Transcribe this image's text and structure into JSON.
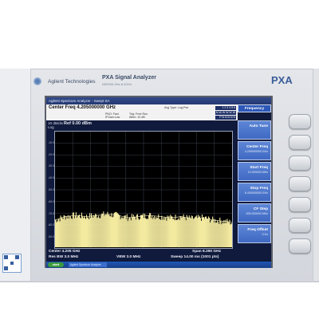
{
  "instrument": {
    "brand": "Agilent Technologies",
    "model": "PXA Signal Analyzer",
    "model_sub": "N9030A   3Hz-8.4GHz",
    "badge": "PXA"
  },
  "screen": {
    "window_title": "Agilent Spectrum Analyzer - Swept SA",
    "center_freq_line": "Center Freq 4.205000000 GHz",
    "status_a": "PNO: Fast",
    "status_b": "IFGain:Low",
    "trig": "Trig: Free Run",
    "atten": "Atten: 10 dB",
    "avg_type": "Avg Type: Log-Pwr",
    "trace_row1": "1 2 3 4 5 6",
    "trace_row2": "M W W W W W",
    "trace_row3": "P N N N N N",
    "scale": "10 dB/div",
    "scale_type": "Log",
    "ref_level": "Ref 0.00 dBm",
    "y_ticks": [
      "-10.0",
      "-20.0",
      "-30.0",
      "-40.0",
      "-50.0",
      "-60.0",
      "-70.0",
      "-80.0",
      "-90.0"
    ],
    "center": "Center 4.205 GHz",
    "res_bw": "Res BW 3.0 MHz",
    "vbw": "VBW 3.0 MHz",
    "span": "Span 8.390 GHz",
    "sweep": "Sweep  14.00 ms (1001 pts)"
  },
  "menu": {
    "title": "Frequency",
    "keys": [
      {
        "label": "Auto Tune",
        "value": ""
      },
      {
        "label": "Center Freq",
        "value": "4.205000000 GHz"
      },
      {
        "label": "Start Freq",
        "value": "10.000000 MHz"
      },
      {
        "label": "Stop Freq",
        "value": "8.400000000 GHz"
      },
      {
        "label": "CF Step",
        "value": "839.000000 MHz"
      },
      {
        "label": "Freq Offset",
        "value": "0 Hz"
      }
    ]
  },
  "taskbar": {
    "start": "start",
    "task": "Agilent Spectrum Analyzer",
    "clock": ""
  },
  "chart_data": {
    "type": "line",
    "x_start_ghz": 0.01,
    "x_stop_ghz": 8.4,
    "ylim": [
      -100,
      0
    ],
    "ylabel": "10 dB/div",
    "grid": true,
    "series": [
      {
        "color": "#f3eaa0",
        "x": [
          0.01,
          0.5,
          1.0,
          1.5,
          2.0,
          2.5,
          3.0,
          3.5,
          4.0,
          4.5,
          5.0,
          5.5,
          6.0,
          6.5,
          7.0,
          7.5,
          8.0,
          8.4
        ],
        "y": [
          -76,
          -73,
          -72,
          -73,
          -72,
          -71,
          -72,
          -74,
          -73,
          -72,
          -73,
          -74,
          -73,
          -75,
          -74,
          -76,
          -77,
          -78
        ]
      }
    ]
  }
}
